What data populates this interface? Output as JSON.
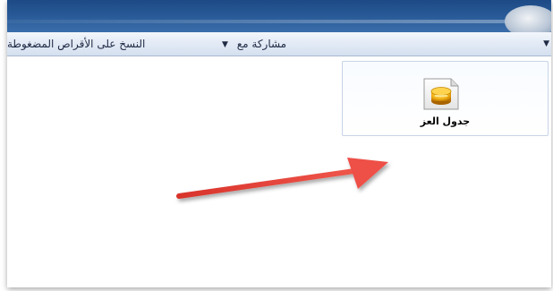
{
  "toolbar": {
    "share_label": "مشاركة مع",
    "burn_label": "النسخ على الأقراص المضغوطة"
  },
  "file": {
    "name": "جدول العز",
    "icon": "access-database-icon"
  },
  "colors": {
    "titlebar": "#2a5c99",
    "toolbar": "#e2eaf5",
    "tile_border": "#c7d4e6",
    "pointer_arrow": "#e0443b"
  }
}
